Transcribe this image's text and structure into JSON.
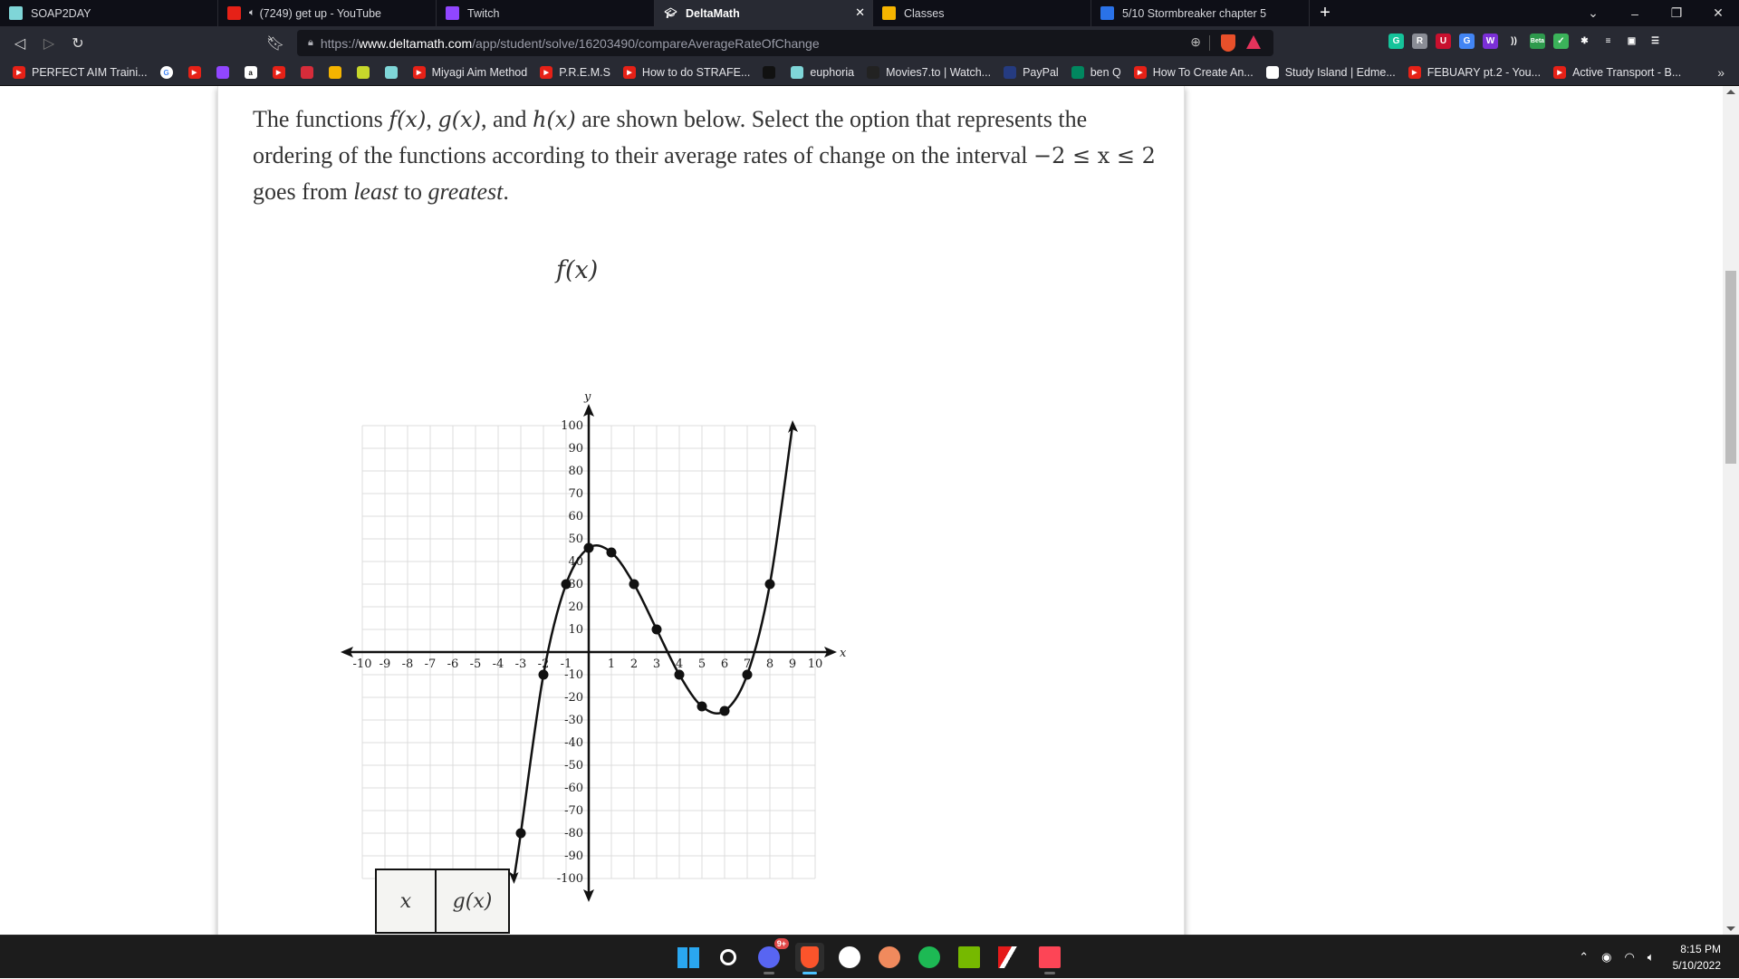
{
  "browser": {
    "tabs": [
      {
        "label": "SOAP2DAY",
        "icon": "soap2day-icon",
        "color": "#7fd6d8",
        "active": false
      },
      {
        "label": "(7249) get up - YouTube",
        "icon": "youtube-icon",
        "color": "#e62117",
        "active": false,
        "audio": true
      },
      {
        "label": "Twitch",
        "icon": "twitch-icon",
        "color": "#9146ff",
        "active": false
      },
      {
        "label": "DeltaMath",
        "icon": "deltamath-icon",
        "color": "#282a33",
        "active": true
      },
      {
        "label": "Classes",
        "icon": "google-classroom-icon",
        "color": "#f5b400",
        "active": false
      },
      {
        "label": "5/10 Stormbreaker chapter 5",
        "icon": "google-docs-icon",
        "color": "#2a72e8",
        "active": false
      }
    ],
    "new_tab_label": "+",
    "tab_close_label": "✕",
    "url": {
      "scheme": "https://",
      "host": "www.deltamath.com",
      "path": "/app/student/solve/16203490/compareAverageRateOfChange"
    },
    "brave_badge_count": "1",
    "extensions": [
      {
        "name": "grammarly-icon",
        "glyph": "G",
        "color": "#15c39a"
      },
      {
        "name": "extension-r-icon",
        "glyph": "R",
        "color": "#8a8d96"
      },
      {
        "name": "extension-shield-icon",
        "glyph": "U",
        "color": "#c8102e"
      },
      {
        "name": "google-translate-icon",
        "glyph": "G",
        "color": "#4285f4"
      },
      {
        "name": "extension-w-icon",
        "glyph": "W",
        "color": "#7b2fd6"
      },
      {
        "name": "extension-wave-icon",
        "glyph": "))",
        "color": "#282a33"
      },
      {
        "name": "beta-extension-icon",
        "glyph": "Beta",
        "color": "#2e9a4d"
      },
      {
        "name": "extension-shield-check-icon",
        "glyph": "✓",
        "color": "#3bb35a"
      },
      {
        "name": "extensions-puzzle-icon",
        "glyph": "✱",
        "color": "#282a33"
      },
      {
        "name": "playlist-icon",
        "glyph": "≡",
        "color": "#282a33"
      },
      {
        "name": "wallet-icon",
        "glyph": "▣",
        "color": "#282a33"
      },
      {
        "name": "menu-icon",
        "glyph": "☰",
        "color": "#282a33"
      }
    ],
    "bookmarks": [
      {
        "label": "PERFECT AIM Traini...",
        "icon": "youtube-icon",
        "color": "#e62117"
      },
      {
        "label": "",
        "icon": "google-icon",
        "color": "#ffffff"
      },
      {
        "label": "",
        "icon": "youtube-icon",
        "color": "#e62117"
      },
      {
        "label": "",
        "icon": "twitch-icon",
        "color": "#9146ff"
      },
      {
        "label": "",
        "icon": "amazon-icon",
        "color": "#ffffff"
      },
      {
        "label": "",
        "icon": "youtube-icon",
        "color": "#e62117"
      },
      {
        "label": "",
        "icon": "g-logo-icon",
        "color": "#d62c3a"
      },
      {
        "label": "",
        "icon": "google-classroom-icon",
        "color": "#f5b400"
      },
      {
        "label": "",
        "icon": "ixl-icon",
        "color": "#c7d82b"
      },
      {
        "label": "",
        "icon": "soap2day-icon",
        "color": "#7fd6d8"
      },
      {
        "label": "Miyagi Aim Method",
        "icon": "youtube-icon",
        "color": "#e62117"
      },
      {
        "label": "P.R.E.M.S",
        "icon": "youtube-icon",
        "color": "#e62117"
      },
      {
        "label": "How to do STRAFE...",
        "icon": "youtube-icon",
        "color": "#e62117"
      },
      {
        "label": "",
        "icon": "m-logo-icon",
        "color": "#111111"
      },
      {
        "label": "euphoria",
        "icon": "soap2day-icon",
        "color": "#7fd6d8"
      },
      {
        "label": "Movies7.to | Watch...",
        "icon": "play-circle-icon",
        "color": "#222222"
      },
      {
        "label": "PayPal",
        "icon": "paypal-icon",
        "color": "#253b80"
      },
      {
        "label": "ben Q",
        "icon": "google-play-icon",
        "color": "#01875f"
      },
      {
        "label": "How To Create An...",
        "icon": "youtube-icon",
        "color": "#e62117"
      },
      {
        "label": "Study Island | Edme...",
        "icon": "edmentum-icon",
        "color": "#ffffff"
      },
      {
        "label": "FEBUARY pt.2 - You...",
        "icon": "youtube-icon",
        "color": "#e62117"
      },
      {
        "label": "Active Transport - B...",
        "icon": "youtube-icon",
        "color": "#e62117"
      }
    ],
    "bookmarks_overflow": "»"
  },
  "question": {
    "p1": "The functions ",
    "f": "f(x)",
    "sep1": ", ",
    "g": "g(x)",
    "sep2": ", and ",
    "h": "h(x)",
    "p2": " are shown below. Select the option that represents the ordering of the functions according to their average rates of change on the interval ",
    "interval": "−2 ≤ x ≤ 2",
    "p3": " goes from ",
    "least": "least",
    "p4": " to ",
    "greatest": "greatest",
    "p5": "."
  },
  "chart_data": {
    "type": "line",
    "title": "f(x)",
    "xlabel": "x",
    "ylabel": "y",
    "xlim": [
      -10,
      10
    ],
    "ylim": [
      -100,
      100
    ],
    "x_ticks": [
      -10,
      -9,
      -8,
      -7,
      -6,
      -5,
      -4,
      -3,
      -2,
      -1,
      1,
      2,
      3,
      4,
      5,
      6,
      7,
      8,
      9,
      10
    ],
    "y_ticks": [
      100,
      90,
      80,
      70,
      60,
      50,
      40,
      30,
      20,
      10,
      -10,
      -20,
      -30,
      -40,
      -50,
      -60,
      -70,
      -80,
      -90,
      -100
    ],
    "grid": true,
    "curve_extends_to": {
      "left_end": [
        -3.3,
        -100
      ],
      "right_end": [
        9,
        100
      ]
    },
    "series": [
      {
        "name": "f(x)",
        "points": [
          {
            "x": -3,
            "y": -80
          },
          {
            "x": -2,
            "y": -10
          },
          {
            "x": -1,
            "y": 30
          },
          {
            "x": 0,
            "y": 46
          },
          {
            "x": 1,
            "y": 44
          },
          {
            "x": 2,
            "y": 30
          },
          {
            "x": 3,
            "y": 10
          },
          {
            "x": 4,
            "y": -10
          },
          {
            "x": 5,
            "y": -24
          },
          {
            "x": 6,
            "y": -26
          },
          {
            "x": 7,
            "y": -10
          },
          {
            "x": 8,
            "y": 30
          }
        ]
      }
    ]
  },
  "table_g": {
    "headers": [
      "x",
      "g(x)"
    ]
  },
  "taskbar": {
    "apps": [
      {
        "name": "start-icon",
        "color": "#2aa7f0"
      },
      {
        "name": "search-icon",
        "color": "#ffffff"
      },
      {
        "name": "discord-icon",
        "color": "#5865f2",
        "badge": "9+"
      },
      {
        "name": "brave-icon",
        "color": "#fb542b",
        "active": true
      },
      {
        "name": "clock-icon",
        "color": "#ffffff"
      },
      {
        "name": "swirl-app-icon",
        "color": "#f08a5d"
      },
      {
        "name": "spotify-icon",
        "color": "#1db954"
      },
      {
        "name": "nvidia-icon",
        "color": "#76b900"
      },
      {
        "name": "msi-icon",
        "color": "#e51a1a"
      },
      {
        "name": "valorant-icon",
        "color": "#fd4556"
      }
    ],
    "time": "8:15 PM",
    "date": "5/10/2022"
  }
}
